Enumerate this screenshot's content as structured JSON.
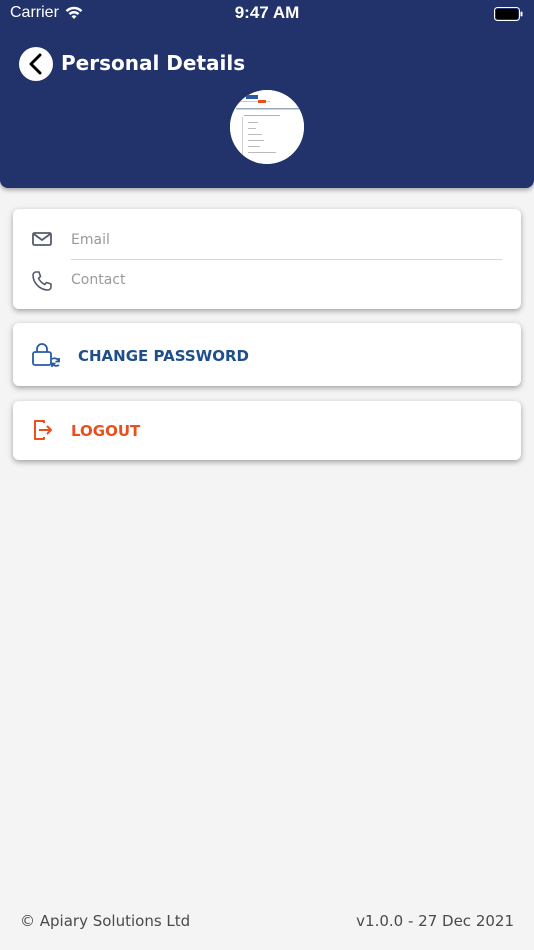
{
  "status_bar": {
    "carrier": "Carrier",
    "time": "9:47 AM"
  },
  "header": {
    "title": "Personal Details"
  },
  "contact": {
    "email_placeholder": "Email",
    "contact_placeholder": "Contact"
  },
  "actions": {
    "change_password": "CHANGE PASSWORD",
    "logout": "LOGOUT"
  },
  "footer": {
    "copyright": "© Apiary Solutions Ltd",
    "version": "v1.0.0 - 27 Dec 2021"
  },
  "colors": {
    "header_bg": "#22336b",
    "primary_blue": "#1f4e8c",
    "logout_orange": "#e8501e"
  }
}
